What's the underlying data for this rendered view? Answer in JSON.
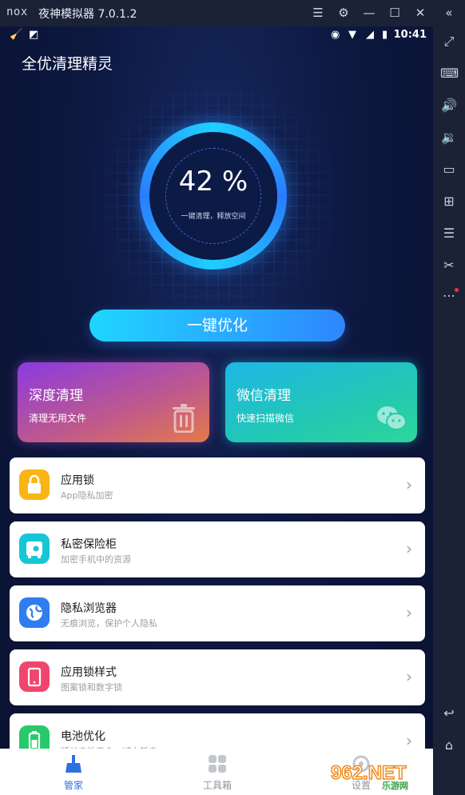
{
  "window": {
    "brand": "nox",
    "title": "夜神模拟器 7.0.1.2",
    "icons": [
      "menu-icon",
      "settings-icon",
      "minimize-icon",
      "maximize-icon",
      "close-icon",
      "collapse-icon"
    ]
  },
  "sidebar": {
    "icons": [
      "fullscreen-icon",
      "keyboard-icon",
      "volume-up-icon",
      "volume-down-icon",
      "screenshot-icon",
      "apk-install-icon",
      "multi-instance-icon",
      "scissors-icon",
      "more-icon",
      "back-icon",
      "home-icon"
    ]
  },
  "statusbar": {
    "time": "10:41"
  },
  "app": {
    "title": "全优清理精灵",
    "percent": "42 %",
    "percent_value": 0.42,
    "ring_subtitle": "一键清理，释放空间",
    "optimize_button": "一键优化",
    "cards": [
      {
        "title": "深度清理",
        "subtitle": "清理无用文件",
        "icon": "trash-icon"
      },
      {
        "title": "微信清理",
        "subtitle": "快速扫描微信",
        "icon": "wechat-icon"
      }
    ],
    "rows": [
      {
        "title": "应用锁",
        "subtitle": "App隐私加密",
        "icon": "lock-icon",
        "color": "#f9b514"
      },
      {
        "title": "私密保险柜",
        "subtitle": "加密手机中的资源",
        "icon": "safe-icon",
        "color": "#16c6d6"
      },
      {
        "title": "隐私浏览器",
        "subtitle": "无痕浏览，保护个人隐私",
        "icon": "globe-icon",
        "color": "#2f7df0"
      },
      {
        "title": "应用锁样式",
        "subtitle": "图案锁和数字锁",
        "icon": "phone-style-icon",
        "color": "#f0466e"
      },
      {
        "title": "电池优化",
        "subtitle": "延长电池寿命，减少耗电",
        "icon": "battery-icon",
        "color": "#27c96a"
      }
    ],
    "nav": [
      {
        "label": "管家",
        "active": true,
        "icon": "broom-icon"
      },
      {
        "label": "工具箱",
        "active": false,
        "icon": "toolbox-icon"
      },
      {
        "label": "设置",
        "active": false,
        "icon": "settings-icon"
      }
    ]
  },
  "watermark": {
    "text": "962.NET",
    "sub": "乐游网"
  }
}
